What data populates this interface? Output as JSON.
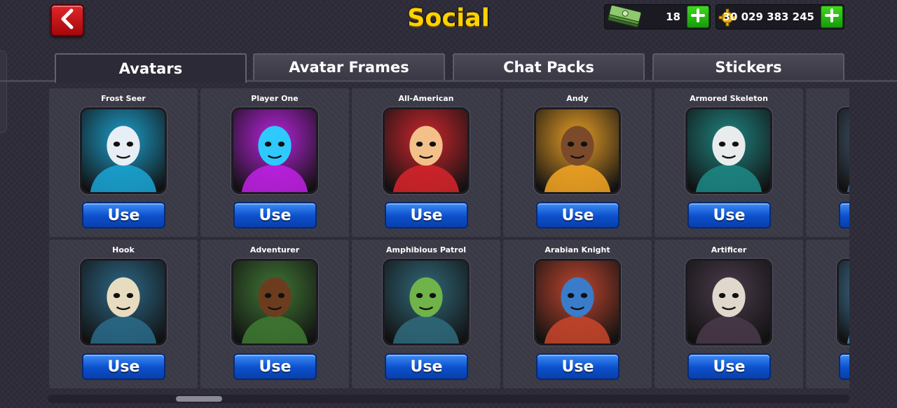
{
  "header": {
    "title": "Social",
    "back_icon": "chevron-left-icon"
  },
  "currency": {
    "cash": {
      "icon": "cash-stack-icon",
      "amount": "18"
    },
    "coins": {
      "icon": "gear-coin-icon",
      "amount": "30 029 383 245"
    }
  },
  "tabs": [
    {
      "label": "Avatars",
      "active": true
    },
    {
      "label": "Avatar Frames",
      "active": false
    },
    {
      "label": "Chat Packs",
      "active": false
    },
    {
      "label": "Stickers",
      "active": false
    }
  ],
  "avatars": [
    {
      "name": "Frost Seer",
      "use_label": "Use",
      "colors": [
        "#1aa6d6",
        "#e8eef5"
      ]
    },
    {
      "name": "Player One",
      "use_label": "Use",
      "colors": [
        "#c221e8",
        "#2ec9ff"
      ]
    },
    {
      "name": "All-American",
      "use_label": "Use",
      "colors": [
        "#d8242b",
        "#f4c08a"
      ]
    },
    {
      "name": "Andy",
      "use_label": "Use",
      "colors": [
        "#f5a623",
        "#7a4a2a"
      ]
    },
    {
      "name": "Armored Skeleton",
      "use_label": "Use",
      "colors": [
        "#1c8a86",
        "#e8ecec"
      ]
    },
    {
      "name": "",
      "use_label": "",
      "colors": [
        "#4d6a86",
        "#c9d2da"
      ]
    },
    {
      "name": "Hook",
      "use_label": "Use",
      "colors": [
        "#2a6b8a",
        "#e8dcc0"
      ]
    },
    {
      "name": "Adventurer",
      "use_label": "Use",
      "colors": [
        "#3f7a32",
        "#6b3d1e"
      ]
    },
    {
      "name": "Amphibious Patrol",
      "use_label": "Use",
      "colors": [
        "#2f6b7c",
        "#6fb34a"
      ]
    },
    {
      "name": "Arabian Knight",
      "use_label": "Use",
      "colors": [
        "#c9462c",
        "#3a7cc9"
      ]
    },
    {
      "name": "Artificer",
      "use_label": "Use",
      "colors": [
        "#4a3a4a",
        "#e0d8cc"
      ]
    },
    {
      "name": "",
      "use_label": "",
      "colors": [
        "#4a8fb8",
        "#e8e0c8"
      ]
    }
  ],
  "scroll": {
    "position": 0.17
  }
}
